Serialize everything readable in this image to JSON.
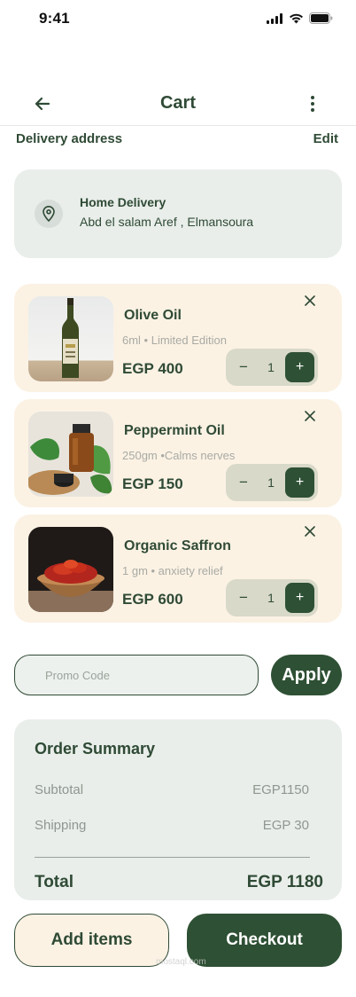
{
  "status_bar": {
    "time": "9:41"
  },
  "header": {
    "title": "Cart"
  },
  "delivery": {
    "section_label": "Delivery address",
    "edit_label": "Edit",
    "title": "Home Delivery",
    "address": "Abd el salam Aref , Elmansoura"
  },
  "items": [
    {
      "name": "Olive Oil",
      "description": "6ml • Limited Edition",
      "price": "EGP 400",
      "quantity": "1"
    },
    {
      "name": "Peppermint Oil",
      "description": "250gm •Calms nerves",
      "price": "EGP 150",
      "quantity": "1"
    },
    {
      "name": "Organic Saffron",
      "description": "1 gm • anxiety relief",
      "price": "EGP 600",
      "quantity": "1"
    }
  ],
  "stepper": {
    "minus": "−",
    "plus": "+"
  },
  "promo": {
    "placeholder": "Promo Code",
    "apply_label": "Apply"
  },
  "summary": {
    "title": "Order Summary",
    "subtotal_label": "Subtotal",
    "subtotal_value": "EGP1150",
    "shipping_label": "Shipping",
    "shipping_value": "EGP 30",
    "total_label": "Total",
    "total_value": "EGP 1180"
  },
  "actions": {
    "add_items_label": "Add items",
    "checkout_label": "Checkout"
  },
  "watermark": {
    "text": "mostaql.com"
  },
  "colors": {
    "primary": "#2e5034",
    "card_cream": "#fbf2e4",
    "card_mint": "#e9eeea"
  }
}
